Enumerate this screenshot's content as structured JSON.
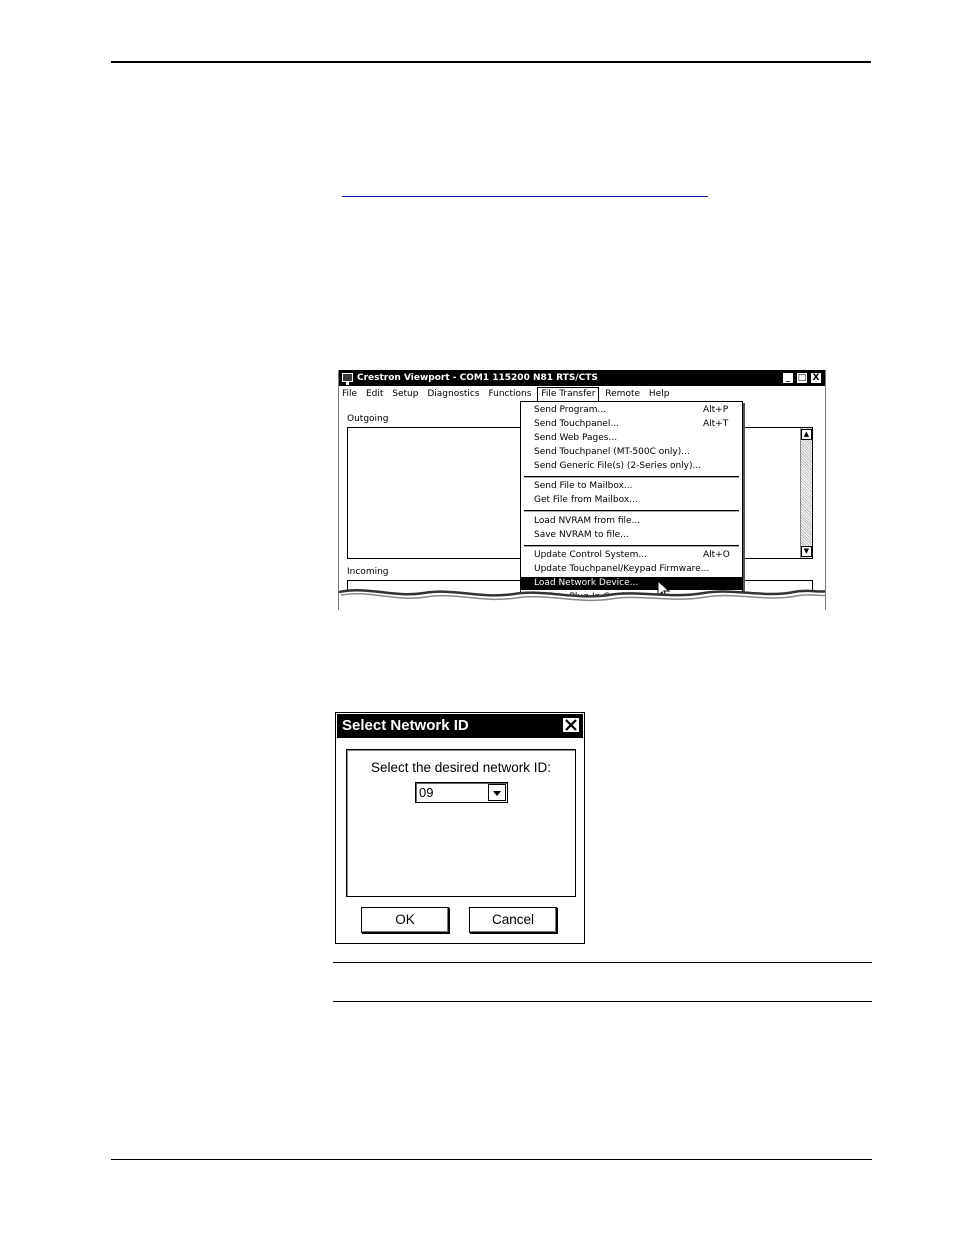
{
  "viewport": {
    "title": "Crestron Viewport - COM1 115200 N81 RTS/CTS",
    "window_buttons": [
      "_",
      "□",
      "X"
    ],
    "menu": [
      "File",
      "Edit",
      "Setup",
      "Diagnostics",
      "Functions",
      "File Transfer",
      "Remote",
      "Help"
    ],
    "active_menu": "File Transfer",
    "outgoing_label": "Outgoing",
    "incoming_label": "Incoming",
    "file_transfer_menu": [
      {
        "label": "Send Program...",
        "shortcut": "Alt+P"
      },
      {
        "label": "Send Touchpanel...",
        "shortcut": "Alt+T"
      },
      {
        "label": "Send Web Pages...",
        "shortcut": ""
      },
      {
        "label": "Send Touchpanel (MT-500C only)...",
        "shortcut": ""
      },
      {
        "label": "Send Generic File(s) (2-Series only)...",
        "shortcut": ""
      },
      {
        "label": "Send File to Mailbox...",
        "shortcut": ""
      },
      {
        "label": "Get File from Mailbox...",
        "shortcut": ""
      },
      {
        "label": "Load NVRAM from file...",
        "shortcut": ""
      },
      {
        "label": "Save NVRAM to file...",
        "shortcut": ""
      },
      {
        "label": "Update Control System...",
        "shortcut": "Alt+O"
      },
      {
        "label": "Update Touchpanel/Keypad Firmware...",
        "shortcut": ""
      },
      {
        "label": "Load Network Device...",
        "shortcut": ""
      },
      {
        "label": "Update Plug-In Card...",
        "shortcut": ""
      }
    ],
    "highlighted_item": "Load Network Device..."
  },
  "dialog": {
    "title": "Select Network ID",
    "prompt": "Select the desired network ID:",
    "selected_id": "09",
    "ok_label": "OK",
    "cancel_label": "Cancel"
  }
}
